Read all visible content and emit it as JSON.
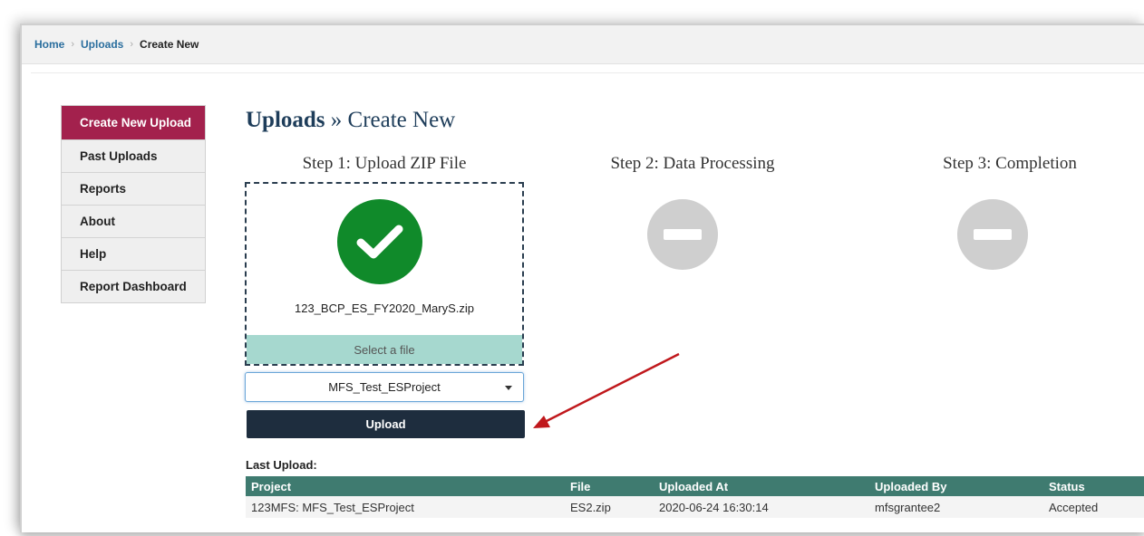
{
  "breadcrumb": {
    "items": [
      "Home",
      "Uploads",
      "Create New"
    ],
    "separator": "›"
  },
  "sidebar": {
    "items": [
      {
        "label": "Create New Upload",
        "active": true
      },
      {
        "label": "Past Uploads",
        "active": false
      },
      {
        "label": "Reports",
        "active": false
      },
      {
        "label": "About",
        "active": false
      },
      {
        "label": "Help",
        "active": false
      },
      {
        "label": "Report Dashboard",
        "active": false
      }
    ]
  },
  "page": {
    "title_bold": "Uploads",
    "title_sep": "»",
    "title_rest": "Create New"
  },
  "steps": [
    {
      "label": "Step 1: Upload ZIP File",
      "status": "complete",
      "icon": "checkmark-icon"
    },
    {
      "label": "Step 2: Data Processing",
      "status": "pending",
      "icon": "minus-icon"
    },
    {
      "label": "Step 3: Completion",
      "status": "pending",
      "icon": "minus-icon"
    }
  ],
  "dropzone": {
    "filename": "123_BCP_ES_FY2020_MaryS.zip",
    "select_label": "Select a file"
  },
  "project_select": {
    "selected": "MFS_Test_ESProject"
  },
  "upload_button": {
    "label": "Upload"
  },
  "last_upload": {
    "label": "Last Upload:",
    "columns": [
      "Project",
      "File",
      "Uploaded At",
      "Uploaded By",
      "Status"
    ],
    "rows": [
      [
        "123MFS: MFS_Test_ESProject",
        "ES2.zip",
        "2020-06-24 16:30:14",
        "mfsgrantee2",
        "Accepted"
      ]
    ]
  },
  "colors": {
    "active_nav": "#a3214d",
    "success": "#108a2a",
    "pending": "#cfcfcf",
    "table_header": "#3f7b70",
    "upload_button": "#1e2d3e",
    "select_file": "#a6d8cf",
    "annotation_arrow": "#c0181c"
  }
}
